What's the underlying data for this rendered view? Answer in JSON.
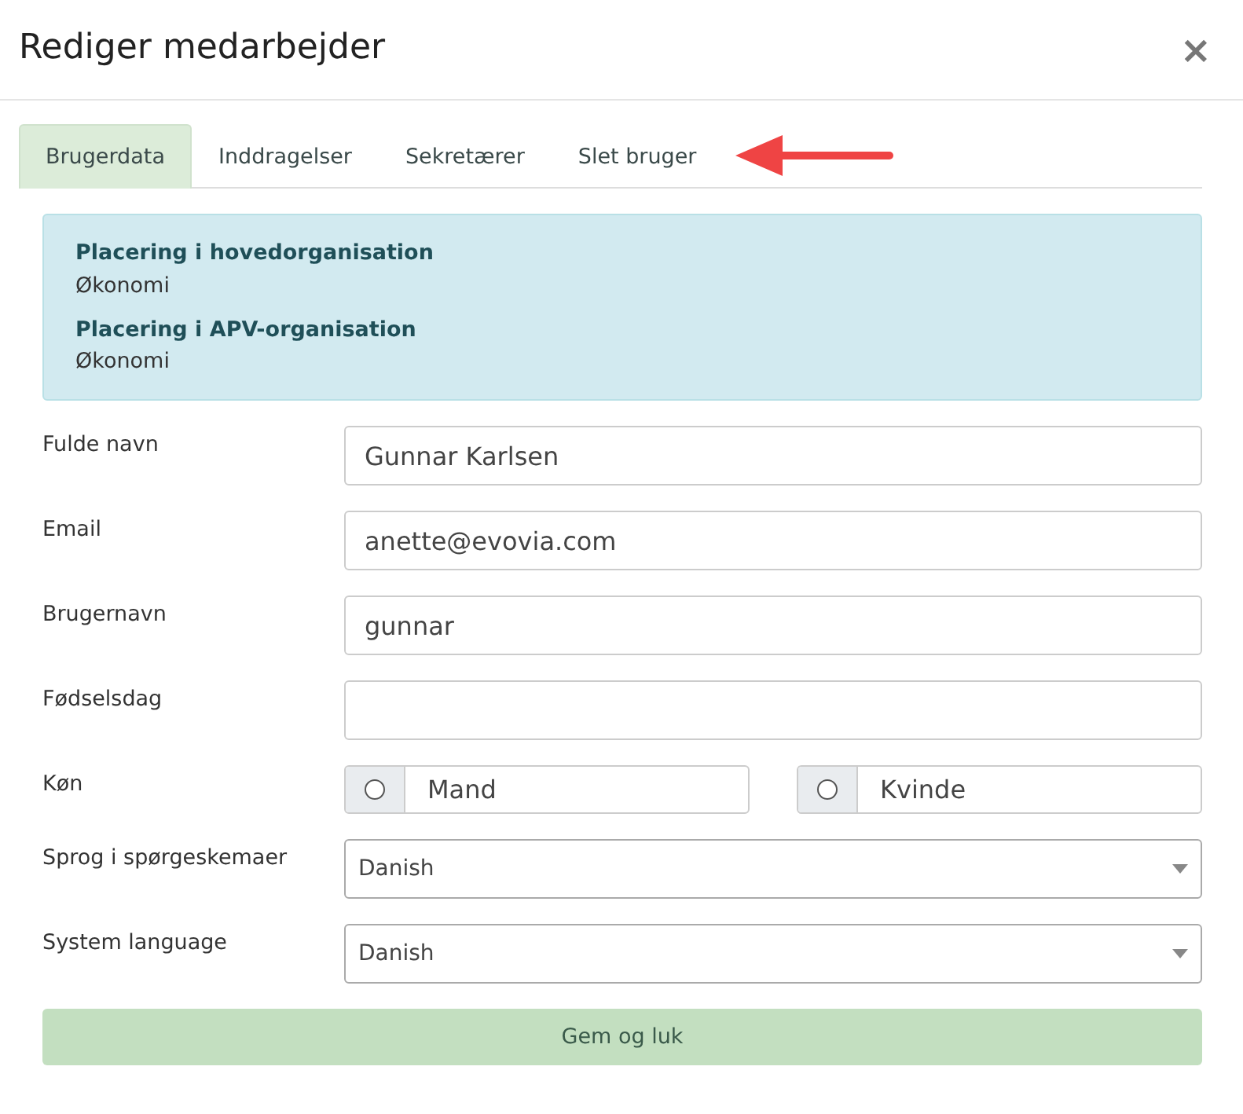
{
  "dialog": {
    "title": "Rediger medarbejder",
    "close": "×"
  },
  "tabs": [
    {
      "label": "Brugerdata",
      "selected": true
    },
    {
      "label": "Inddragelser",
      "selected": false
    },
    {
      "label": "Sekretærer",
      "selected": false
    },
    {
      "label": "Slet bruger",
      "selected": false
    }
  ],
  "info": [
    {
      "heading": "Placering i hovedorganisation",
      "value": "Økonomi"
    },
    {
      "heading": "Placering i APV-organisation",
      "value": "Økonomi"
    }
  ],
  "fields": [
    {
      "kind": "text",
      "label": "Fulde navn",
      "value": "Gunnar Karlsen"
    },
    {
      "kind": "text",
      "label": "Email",
      "value": "anette@evovia.com"
    },
    {
      "kind": "text",
      "label": "Brugernavn",
      "value": "gunnar"
    },
    {
      "kind": "text",
      "label": "Fødselsdag"
    },
    {
      "kind": "radio",
      "label": "Køn",
      "options": [
        {
          "label": "Mand",
          "checked": false
        },
        {
          "label": "Kvinde",
          "checked": false
        }
      ]
    },
    {
      "kind": "select",
      "label": "Sprog i spørgeskemaer",
      "value": "Danish"
    },
    {
      "kind": "select",
      "label": "System language",
      "value": "Danish"
    }
  ],
  "submit": "Gem og luk"
}
